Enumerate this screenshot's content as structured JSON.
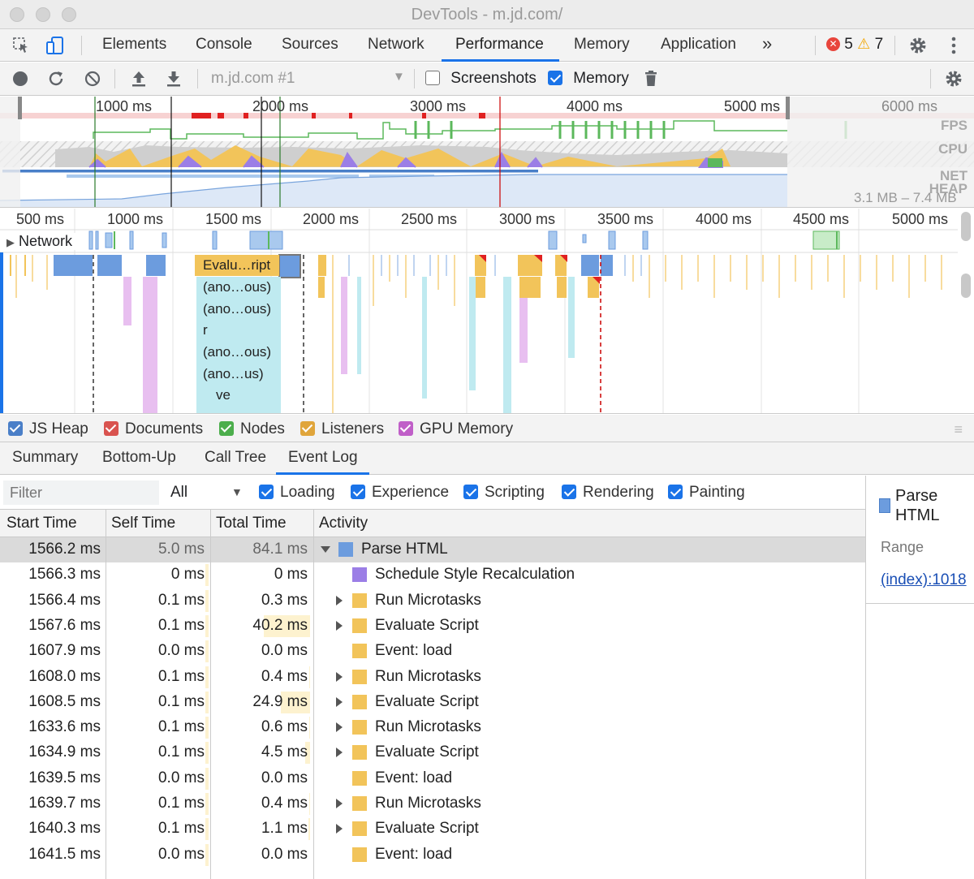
{
  "window": {
    "title": "DevTools - m.jd.com/"
  },
  "main_tabs": [
    "Elements",
    "Console",
    "Sources",
    "Network",
    "Performance",
    "Memory",
    "Application"
  ],
  "more_tabs": "»",
  "issues": {
    "errors": "5",
    "warnings": "7"
  },
  "perf_toolbar": {
    "profile_select": "m.jd.com #1",
    "screenshots_label": "Screenshots",
    "screenshots_checked": false,
    "memory_label": "Memory",
    "memory_checked": true
  },
  "overview": {
    "ticks": [
      "1000 ms",
      "2000 ms",
      "3000 ms",
      "4000 ms",
      "5000 ms",
      "6000 ms"
    ],
    "tracks": [
      "FPS",
      "CPU",
      "NET",
      "HEAP"
    ],
    "heap_range": "3.1 MB – 7.4 MB"
  },
  "flame": {
    "ticks": [
      "500 ms",
      "1000 ms",
      "1500 ms",
      "2000 ms",
      "2500 ms",
      "3000 ms",
      "3500 ms",
      "4000 ms",
      "4500 ms",
      "5000 ms"
    ],
    "network_label": "Network",
    "stack": [
      "Evalu…ript",
      "(ano…ous)",
      "(ano…ous)",
      "r",
      "(ano…ous)",
      "(ano…us)",
      "ve"
    ]
  },
  "counters": [
    {
      "label": "JS Heap",
      "color": "#4a7fc8"
    },
    {
      "label": "Documents",
      "color": "#d9534f"
    },
    {
      "label": "Nodes",
      "color": "#4cae4c"
    },
    {
      "label": "Listeners",
      "color": "#e0a53b"
    },
    {
      "label": "GPU Memory",
      "color": "#c05fc8"
    }
  ],
  "sub_tabs": [
    "Summary",
    "Bottom-Up",
    "Call Tree",
    "Event Log"
  ],
  "filter": {
    "placeholder": "Filter",
    "duration": "All",
    "categories": [
      "Loading",
      "Experience",
      "Scripting",
      "Rendering",
      "Painting"
    ]
  },
  "table": {
    "headers": [
      "Start Time",
      "Self Time",
      "Total Time",
      "Activity"
    ],
    "rows": [
      {
        "start": "1566.2 ms",
        "self": "5.0 ms",
        "total": "84.1 ms",
        "activity": "Parse HTML",
        "color": "#6c9cde",
        "expand": "down",
        "indent": 0,
        "selected": true
      },
      {
        "start": "1566.3 ms",
        "self": "0 ms",
        "total": "0 ms",
        "activity": "Schedule Style Recalculation",
        "color": "#9b7ee6",
        "expand": "none",
        "indent": 1
      },
      {
        "start": "1566.4 ms",
        "self": "0.1 ms",
        "total": "0.3 ms",
        "activity": "Run Microtasks",
        "color": "#f2c45a",
        "expand": "right",
        "indent": 1
      },
      {
        "start": "1567.6 ms",
        "self": "0.1 ms",
        "total": "40.2 ms",
        "activity": "Evaluate Script",
        "color": "#f2c45a",
        "expand": "right",
        "indent": 1
      },
      {
        "start": "1607.9 ms",
        "self": "0.0 ms",
        "total": "0.0 ms",
        "activity": "Event: load",
        "color": "#f2c45a",
        "expand": "none",
        "indent": 1
      },
      {
        "start": "1608.0 ms",
        "self": "0.1 ms",
        "total": "0.4 ms",
        "activity": "Run Microtasks",
        "color": "#f2c45a",
        "expand": "right",
        "indent": 1
      },
      {
        "start": "1608.5 ms",
        "self": "0.1 ms",
        "total": "24.9 ms",
        "activity": "Evaluate Script",
        "color": "#f2c45a",
        "expand": "right",
        "indent": 1
      },
      {
        "start": "1633.6 ms",
        "self": "0.1 ms",
        "total": "0.6 ms",
        "activity": "Run Microtasks",
        "color": "#f2c45a",
        "expand": "right",
        "indent": 1
      },
      {
        "start": "1634.9 ms",
        "self": "0.1 ms",
        "total": "4.5 ms",
        "activity": "Evaluate Script",
        "color": "#f2c45a",
        "expand": "right",
        "indent": 1
      },
      {
        "start": "1639.5 ms",
        "self": "0.0 ms",
        "total": "0.0 ms",
        "activity": "Event: load",
        "color": "#f2c45a",
        "expand": "none",
        "indent": 1
      },
      {
        "start": "1639.7 ms",
        "self": "0.1 ms",
        "total": "0.4 ms",
        "activity": "Run Microtasks",
        "color": "#f2c45a",
        "expand": "right",
        "indent": 1
      },
      {
        "start": "1640.3 ms",
        "self": "0.1 ms",
        "total": "1.1 ms",
        "activity": "Evaluate Script",
        "color": "#f2c45a",
        "expand": "right",
        "indent": 1
      },
      {
        "start": "1641.5 ms",
        "self": "0.0 ms",
        "total": "0.0 ms",
        "activity": "Event: load",
        "color": "#f2c45a",
        "expand": "none",
        "indent": 1
      }
    ]
  },
  "details": {
    "title": "Parse HTML",
    "range_label": "Range",
    "source_link": "(index):1018"
  }
}
